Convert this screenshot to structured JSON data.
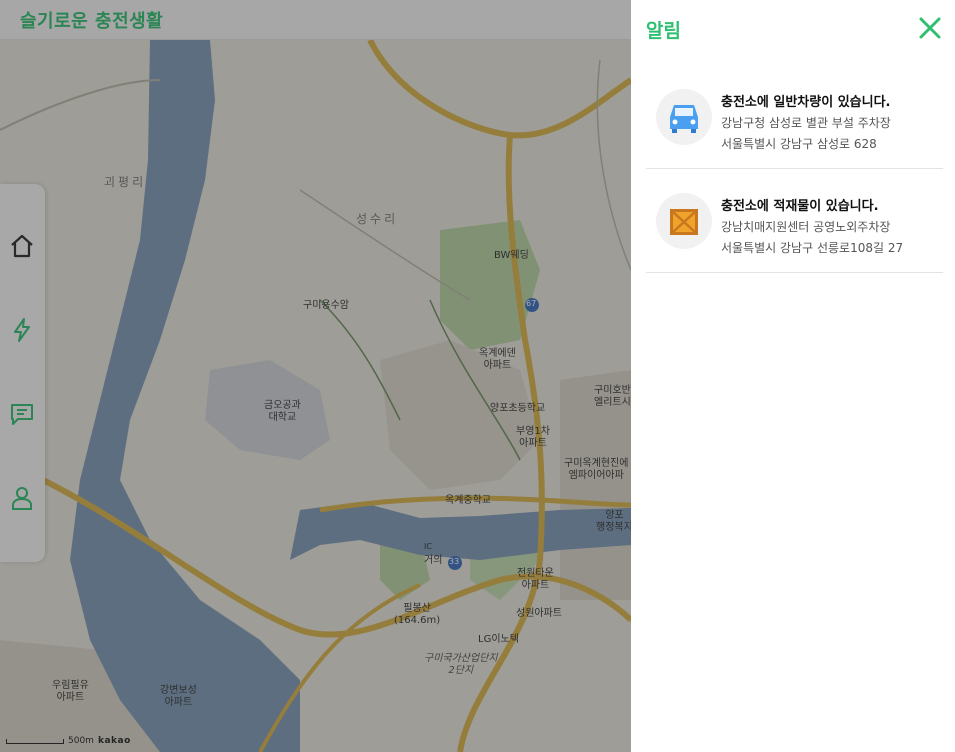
{
  "header": {
    "app_title": "슬기로운 충전생활"
  },
  "map": {
    "labels": {
      "gwangpyeong": "괴평리",
      "seongsu": "성수리",
      "bw": "BW웨딩",
      "gumi_yongsu": "구미용수암",
      "okgye_eden": "옥계에덴\n아파트",
      "kumoh": "금오공과\n대학교",
      "yangpo_elem": "양포초등학교",
      "buyoung": "부영1차\n아파트",
      "gumi_hoban": "구미호반\n엘리트시",
      "gumi_okgye_hyundai": "구미옥계현진에\n엠파이어아파",
      "okgye_middle": "옥계중학교",
      "yangpo_office": "양포\n행정복지",
      "jeonwon": "전원타운\n아파트",
      "pilbong": "필봉산\n(164.6m)",
      "seongwon": "성원아파트",
      "lg": "LG이노텍",
      "industrial": "구미국가산업단지\n2단지",
      "woorim": "우림필유\n아파트",
      "gangbyeon": "강변보성\n아파트",
      "road_67": "67",
      "road_33": "33",
      "geoui": "거의",
      "ic": "IC"
    },
    "scale_label": "500m",
    "brand": "kakao"
  },
  "sidenav": {
    "items": [
      {
        "icon": "home-icon"
      },
      {
        "icon": "lightning-icon"
      },
      {
        "icon": "chat-icon"
      },
      {
        "icon": "user-icon"
      }
    ]
  },
  "panel": {
    "title": "알림",
    "close_icon": "close-icon",
    "notifications": [
      {
        "icon": "car-icon",
        "title": "충전소에 일반차량이 있습니다.",
        "place": "강남구청 삼성로 별관 부설 주차장",
        "address": "서울특별시 강남구 삼성로 628"
      },
      {
        "icon": "box-icon",
        "title": "충전소에 적재물이 있습니다.",
        "place": "강남치매지원센터 공영노외주차장",
        "address": "서울특별시 강남구 선릉로108길 27"
      }
    ]
  },
  "colors": {
    "accent": "#2fbf71",
    "car": "#4a9ff0",
    "box": "#f0a32a"
  }
}
